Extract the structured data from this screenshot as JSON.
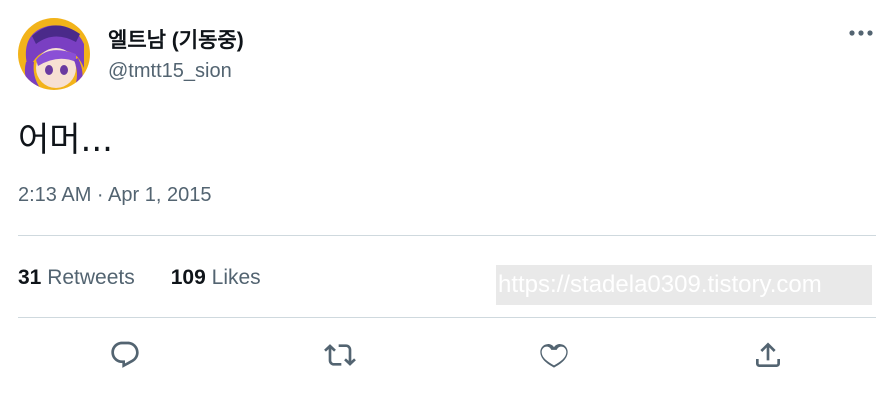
{
  "tweet": {
    "author": {
      "display_name": "엘트남 (기동중)",
      "handle": "@tmtt15_sion",
      "avatar": "anime-avatar"
    },
    "text": "어머...",
    "timestamp": "2:13 AM · Apr 1, 2015",
    "stats": {
      "retweets_count": "31",
      "retweets_label": "Retweets",
      "likes_count": "109",
      "likes_label": "Likes"
    },
    "actions": [
      "reply-icon",
      "retweet-icon",
      "like-icon",
      "share-icon"
    ],
    "more_icon": "more-icon"
  },
  "watermark": {
    "text": "https://stadela0309.tistory.com"
  },
  "colors": {
    "text_primary": "#0f1419",
    "text_secondary": "#536471",
    "divider": "#cfd9de"
  }
}
